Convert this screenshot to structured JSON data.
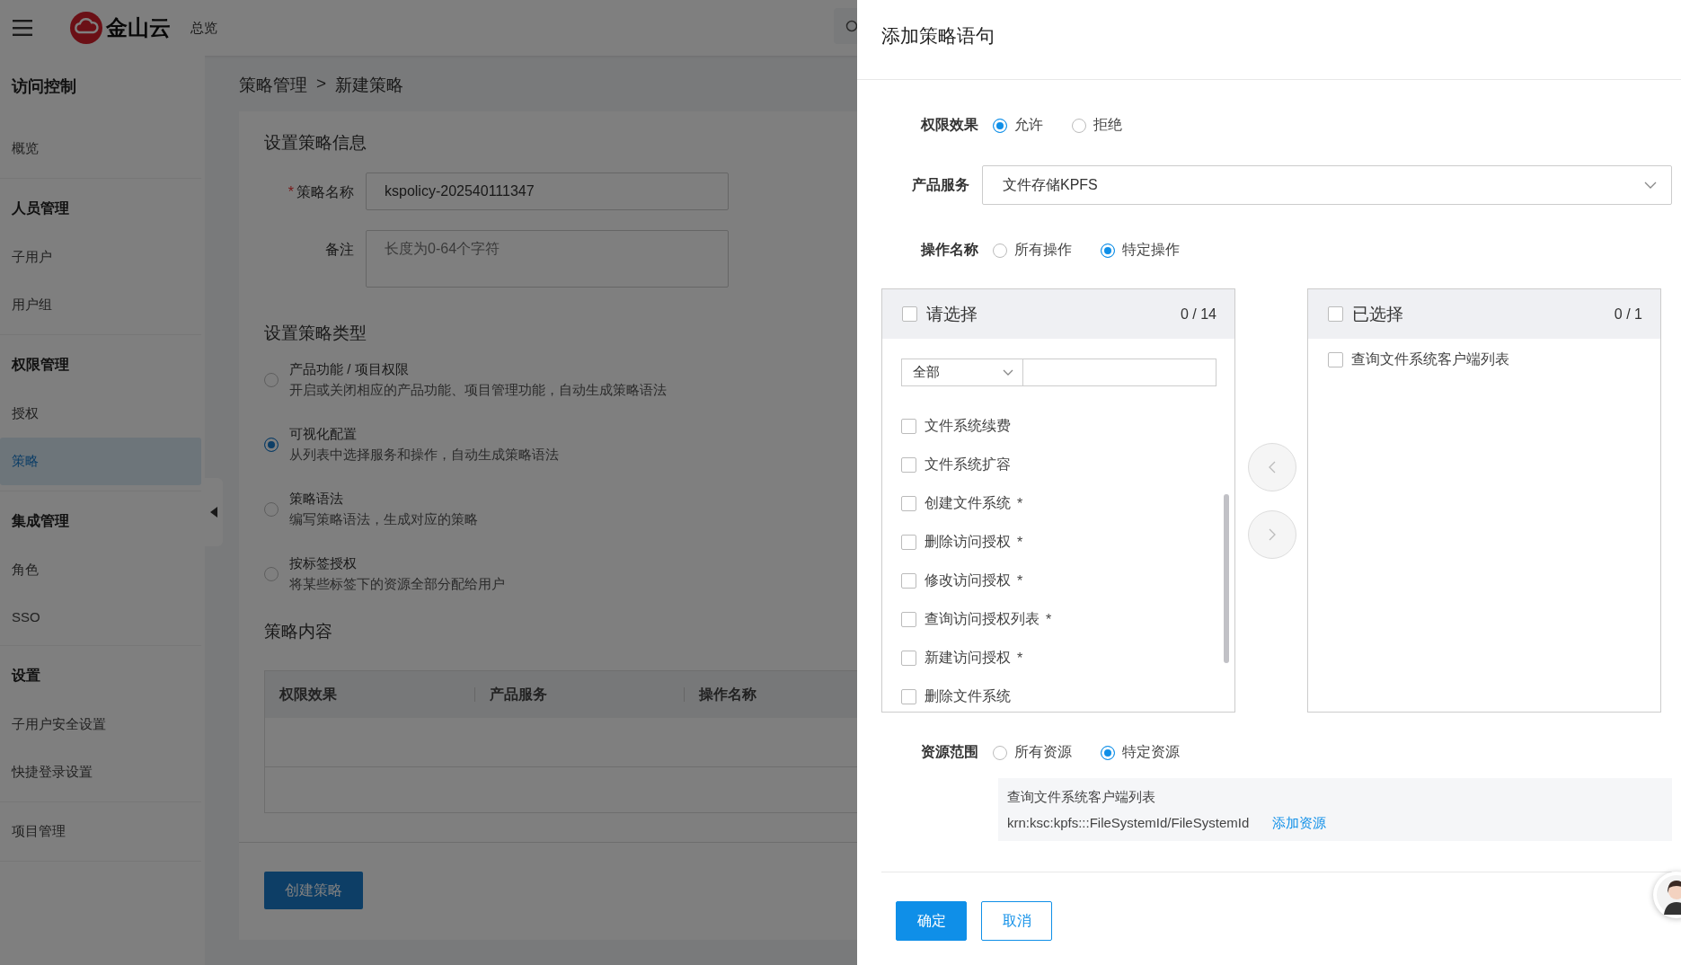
{
  "header": {
    "logo_text": "金山云",
    "nav": "总览"
  },
  "sidebar": {
    "title": "访问控制",
    "groups": [
      {
        "items": [
          {
            "label": "概览",
            "selected": false
          }
        ]
      },
      {
        "heading": "人员管理",
        "items": [
          {
            "label": "子用户",
            "selected": false
          },
          {
            "label": "用户组",
            "selected": false
          }
        ]
      },
      {
        "heading": "权限管理",
        "items": [
          {
            "label": "授权",
            "selected": false
          },
          {
            "label": "策略",
            "selected": true
          }
        ]
      },
      {
        "heading": "集成管理",
        "items": [
          {
            "label": "角色",
            "selected": false
          },
          {
            "label": "SSO",
            "selected": false
          }
        ]
      },
      {
        "heading": "设置",
        "items": [
          {
            "label": "子用户安全设置",
            "selected": false
          },
          {
            "label": "快捷登录设置",
            "selected": false
          }
        ]
      },
      {
        "items": [
          {
            "label": "项目管理",
            "selected": false
          }
        ]
      }
    ]
  },
  "breadcrumb": {
    "items": [
      "策略管理",
      "新建策略"
    ],
    "separator": ">"
  },
  "info": {
    "title": "设置策略信息",
    "name_label": "策略名称",
    "name_required": "*",
    "name_value": "kspolicy-202540111347",
    "note_label": "备注",
    "note_placeholder": "长度为0-64个字符"
  },
  "policy_type": {
    "title": "设置策略类型",
    "options": [
      {
        "title": "产品功能 / 项目权限",
        "desc": "开启或关闭相应的产品功能、项目管理功能，自动生成策略语法",
        "selected": false
      },
      {
        "title": "可视化配置",
        "desc": "从列表中选择服务和操作，自动生成策略语法",
        "selected": true
      },
      {
        "title": "策略语法",
        "desc": "编写策略语法，生成对应的策略",
        "selected": false
      },
      {
        "title": "按标签授权",
        "desc": "将某些标签下的资源全部分配给用户",
        "selected": false
      }
    ]
  },
  "content": {
    "title": "策略内容",
    "columns": [
      "权限效果",
      "产品服务",
      "操作名称"
    ]
  },
  "create_button": "创建策略",
  "drawer": {
    "title": "添加策略语句",
    "effect": {
      "label": "权限效果",
      "options": [
        {
          "label": "允许",
          "selected": true
        },
        {
          "label": "拒绝",
          "selected": false
        }
      ]
    },
    "product": {
      "label": "产品服务",
      "value": "文件存储KPFS"
    },
    "action": {
      "label": "操作名称",
      "options": [
        {
          "label": "所有操作",
          "selected": false
        },
        {
          "label": "特定操作",
          "selected": true
        }
      ]
    },
    "transfer": {
      "left": {
        "title": "请选择",
        "count": "0 / 14",
        "checked": false,
        "filter": "全部",
        "items": [
          {
            "label": "文件系统续费",
            "checked": false
          },
          {
            "label": "文件系统扩容",
            "checked": false
          },
          {
            "label": "创建文件系统",
            "mark": "*",
            "checked": false
          },
          {
            "label": "删除访问授权",
            "mark": "*",
            "checked": false
          },
          {
            "label": "修改访问授权",
            "mark": "*",
            "checked": false
          },
          {
            "label": "查询访问授权列表",
            "mark": "*",
            "checked": false
          },
          {
            "label": "新建访问授权",
            "mark": "*",
            "checked": false
          },
          {
            "label": "删除文件系统",
            "checked": false
          }
        ]
      },
      "right": {
        "title": "已选择",
        "count": "0 / 1",
        "checked": false,
        "items": [
          {
            "label": "查询文件系统客户端列表",
            "checked": false
          }
        ]
      }
    },
    "resource": {
      "label": "资源范围",
      "options": [
        {
          "label": "所有资源",
          "selected": false
        },
        {
          "label": "特定资源",
          "selected": true
        }
      ],
      "entry": {
        "name": "查询文件系统客户端列表",
        "arn": "krn:ksc:kpfs:::FileSystemId/FileSystemId",
        "link": "添加资源"
      }
    },
    "buttons": [
      {
        "label": "确定",
        "kind": "primary"
      },
      {
        "label": "取消",
        "kind": "secondary"
      }
    ]
  }
}
